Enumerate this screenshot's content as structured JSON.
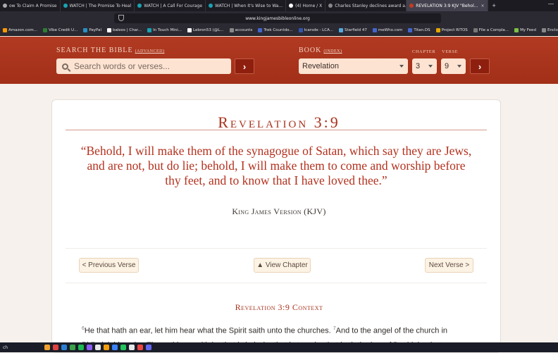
{
  "browser": {
    "tabs": [
      {
        "label": "ow To Claim A Promise",
        "color": "#aaa"
      },
      {
        "label": "WATCH | The Promise To Heal",
        "color": "#19a3b3"
      },
      {
        "label": "WATCH | A Call For Courage",
        "color": "#19a3b3"
      },
      {
        "label": "WATCH | When It's Wise to Wa...",
        "color": "#19a3b3"
      },
      {
        "label": "(4) Home / X",
        "color": "#ffffff"
      },
      {
        "label": "Charles Stanley declines award a...",
        "color": "#888"
      },
      {
        "label": "REVELATION 3:9 KJV \"Behol...",
        "color": "#c23b22",
        "active": true
      }
    ],
    "new_tab": "+",
    "url": "www.kingjamesbibleonline.org",
    "bookmarks": [
      {
        "label": "Amazon.com...",
        "color": "#ff9900"
      },
      {
        "label": "Vibe Credit U...",
        "color": "#2e7d32"
      },
      {
        "label": "PayPal",
        "color": "#2790c3"
      },
      {
        "label": "baleos | Char...",
        "color": "#fff"
      },
      {
        "label": "In Touch Mini...",
        "color": "#19a3b3"
      },
      {
        "label": "Lebron53 (@L...",
        "color": "#fff"
      },
      {
        "label": "accounts",
        "color": "#888"
      },
      {
        "label": "Trek Countdo...",
        "color": "#4466cc"
      },
      {
        "label": "Icarsde - LCA...",
        "color": "#3355aa"
      },
      {
        "label": "Starfield 47",
        "color": "#55aadd"
      },
      {
        "label": "meWho.com",
        "color": "#4466cc"
      },
      {
        "label": "Titan.DS",
        "color": "#4466cc"
      },
      {
        "label": "Project RITOS",
        "color": "#e6a700"
      },
      {
        "label": "File a Compla...",
        "color": "#777"
      },
      {
        "label": "My Feed",
        "color": "#7cc142"
      },
      {
        "label": "Enclosed Co...",
        "color": "#888"
      }
    ]
  },
  "header": {
    "search_label": "SEARCH THE BIBLE",
    "search_advanced": "(ADVANCED)",
    "search_placeholder": "Search words or verses...",
    "go_symbol": "›",
    "book_label": "BOOK",
    "book_index": "(INDEX)",
    "chapter_label": "CHAPTER",
    "verse_label": "VERSE",
    "book_value": "Revelation",
    "chapter_value": "3",
    "verse_value": "9"
  },
  "main": {
    "title": "Revelation 3:9",
    "verse_text": "“Behold, I will make them of the synagogue of Satan, which say they are Jews, and are not, but do lie; behold, I will make them to come and worship before thy feet, and to know that I have loved thee.”",
    "version": "King James Version (KJV)",
    "prev_button": "< Previous Verse",
    "chapter_button": "▲ View Chapter",
    "next_button": "Next Verse >",
    "context_title": "Revelation 3:9 Context",
    "context_v6_num": "6",
    "context_v6": "He that hath an ear, let him hear what the Spirit saith unto the churches. ",
    "context_v7_num": "7",
    "context_v7": "And to the angel of the church in Philadelphia write; These things saith he that is holy, he that is true, he that hath the key of David, he that"
  },
  "taskbar": {
    "left_text": "ch"
  }
}
